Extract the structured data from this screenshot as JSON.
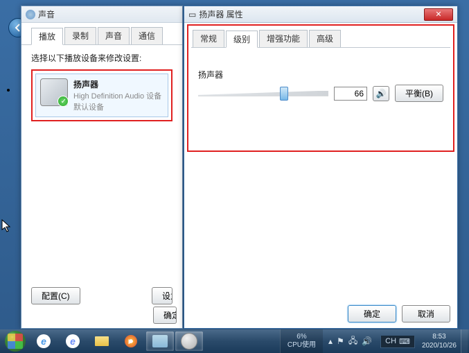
{
  "sound_window": {
    "title": "声音",
    "tabs": [
      "播放",
      "录制",
      "声音",
      "通信"
    ],
    "active_tab": 0,
    "instruction": "选择以下播放设备来修改设置:",
    "device": {
      "name": "扬声器",
      "sub1": "High Definition Audio 设备",
      "sub2": "默认设备"
    },
    "configure_btn": "配置(C)",
    "set_default_partial": "设为",
    "ok_partial": "确定"
  },
  "props_window": {
    "title": "扬声器 属性",
    "tabs": [
      "常规",
      "级别",
      "增强功能",
      "高级"
    ],
    "active_tab": 1,
    "slider_label": "扬声器",
    "slider_value": "66",
    "slider_percent": 66,
    "balance_btn": "平衡(B)",
    "ok_btn": "确定",
    "cancel_btn": "取消"
  },
  "taskbar": {
    "cpu_percent": "6%",
    "cpu_label": "CPU使用",
    "lang": "CH",
    "time": "8:53",
    "date": "2020/10/26"
  }
}
